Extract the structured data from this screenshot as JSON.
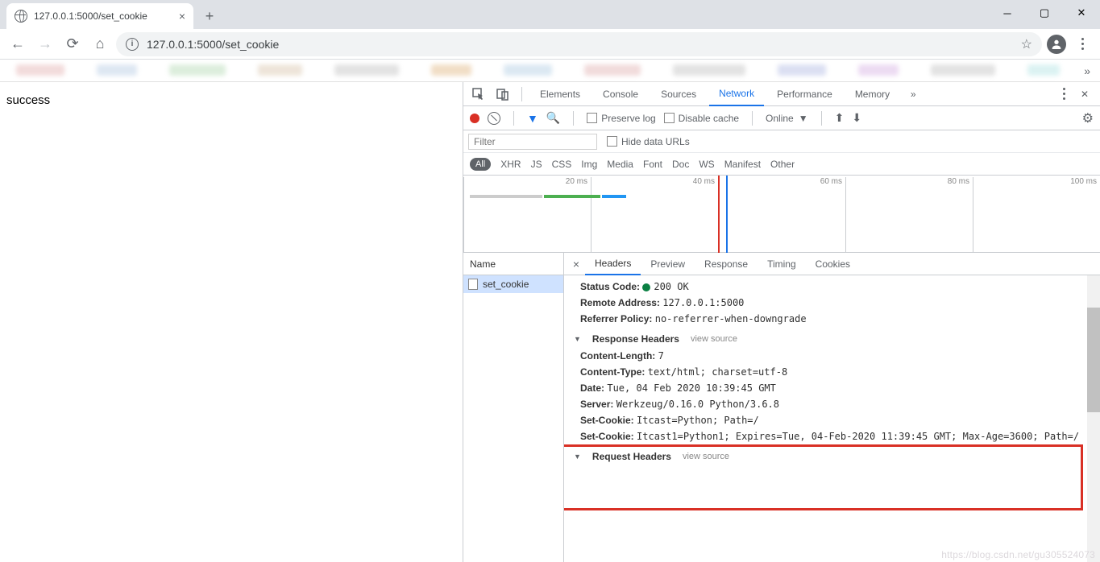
{
  "tab": {
    "title": "127.0.0.1:5000/set_cookie"
  },
  "url": "127.0.0.1:5000/set_cookie",
  "page_text": "success",
  "devtools": {
    "tabs": [
      "Elements",
      "Console",
      "Sources",
      "Network",
      "Performance",
      "Memory"
    ],
    "active_tab": "Network",
    "preserve_log": "Preserve log",
    "disable_cache": "Disable cache",
    "online": "Online",
    "filter_placeholder": "Filter",
    "hide_data_urls": "Hide data URLs",
    "types": [
      "All",
      "XHR",
      "JS",
      "CSS",
      "Img",
      "Media",
      "Font",
      "Doc",
      "WS",
      "Manifest",
      "Other"
    ],
    "timeline_labels": [
      "20 ms",
      "40 ms",
      "60 ms",
      "80 ms",
      "100 ms"
    ]
  },
  "request_list": {
    "header": "Name",
    "items": [
      "set_cookie"
    ]
  },
  "detail_tabs": [
    "Headers",
    "Preview",
    "Response",
    "Timing",
    "Cookies"
  ],
  "headers": {
    "status_label": "Status Code:",
    "status_value": "200 OK",
    "remote_label": "Remote Address:",
    "remote_value": "127.0.0.1:5000",
    "referrer_label": "Referrer Policy:",
    "referrer_value": "no-referrer-when-downgrade",
    "response_section": "Response Headers",
    "view_source": "view source",
    "content_length_label": "Content-Length:",
    "content_length_value": "7",
    "content_type_label": "Content-Type:",
    "content_type_value": "text/html; charset=utf-8",
    "date_label": "Date:",
    "date_value": "Tue, 04 Feb 2020 10:39:45 GMT",
    "server_label": "Server:",
    "server_value": "Werkzeug/0.16.0 Python/3.6.8",
    "set_cookie1_label": "Set-Cookie:",
    "set_cookie1_value": "Itcast=Python; Path=/",
    "set_cookie2_label": "Set-Cookie:",
    "set_cookie2_value": "Itcast1=Python1; Expires=Tue, 04-Feb-2020 11:39:45 GMT; Max-Age=3600; Path=/",
    "request_section": "Request Headers"
  },
  "watermark": "https://blog.csdn.net/gu305524073"
}
